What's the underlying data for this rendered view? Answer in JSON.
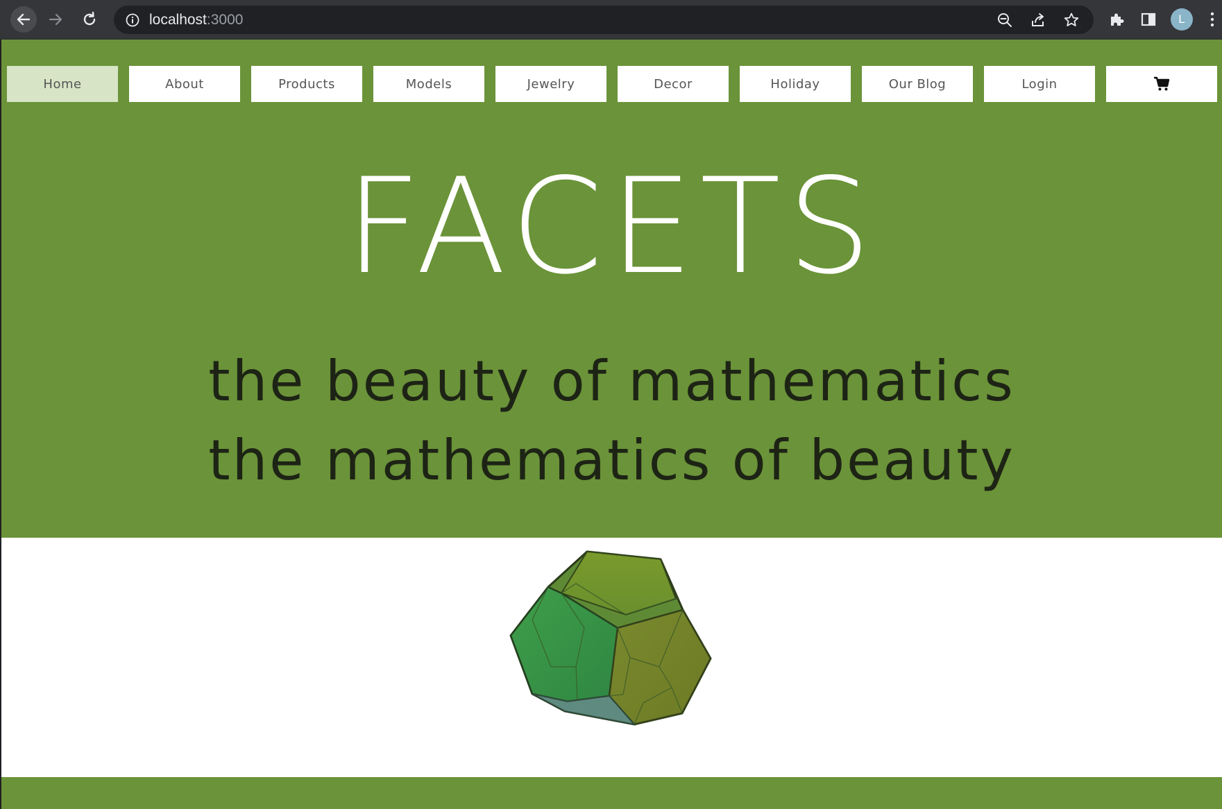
{
  "browser": {
    "url_host": "localhost",
    "url_port": ":3000",
    "profile_initial": "L"
  },
  "nav": {
    "items": [
      {
        "label": "Home",
        "active": true
      },
      {
        "label": "About",
        "active": false
      },
      {
        "label": "Products",
        "active": false
      },
      {
        "label": "Models",
        "active": false
      },
      {
        "label": "Jewelry",
        "active": false
      },
      {
        "label": "Decor",
        "active": false
      },
      {
        "label": "Holiday",
        "active": false
      },
      {
        "label": "Our Blog",
        "active": false
      },
      {
        "label": "Login",
        "active": false
      }
    ],
    "cart_icon": "shopping-cart-icon"
  },
  "hero": {
    "title": "FACETS",
    "tagline_1": "the beauty of mathematics",
    "tagline_2": "the mathematics of beauty"
  },
  "colors": {
    "brand_green": "#6b9339",
    "active_nav": "#d7e4c6",
    "chrome_dark": "#35363a"
  }
}
